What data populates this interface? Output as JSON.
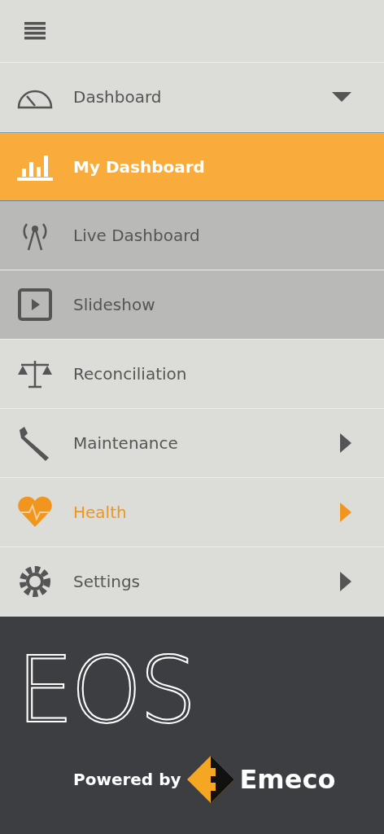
{
  "menu": [
    {
      "label": "Dashboard",
      "expanded": true,
      "active": false,
      "children": [
        {
          "label": "My Dashboard",
          "selected": true
        },
        {
          "label": "Live Dashboard",
          "selected": false
        },
        {
          "label": "Slideshow",
          "selected": false
        }
      ]
    },
    {
      "label": "Reconciliation",
      "active": false
    },
    {
      "label": "Maintenance",
      "expanded": false,
      "active": false
    },
    {
      "label": "Health",
      "expanded": false,
      "active": true
    },
    {
      "label": "Settings",
      "expanded": false,
      "active": false
    }
  ],
  "footer": {
    "logo": "EOS",
    "powered_by": "Powered by",
    "brand": "Emeco"
  }
}
